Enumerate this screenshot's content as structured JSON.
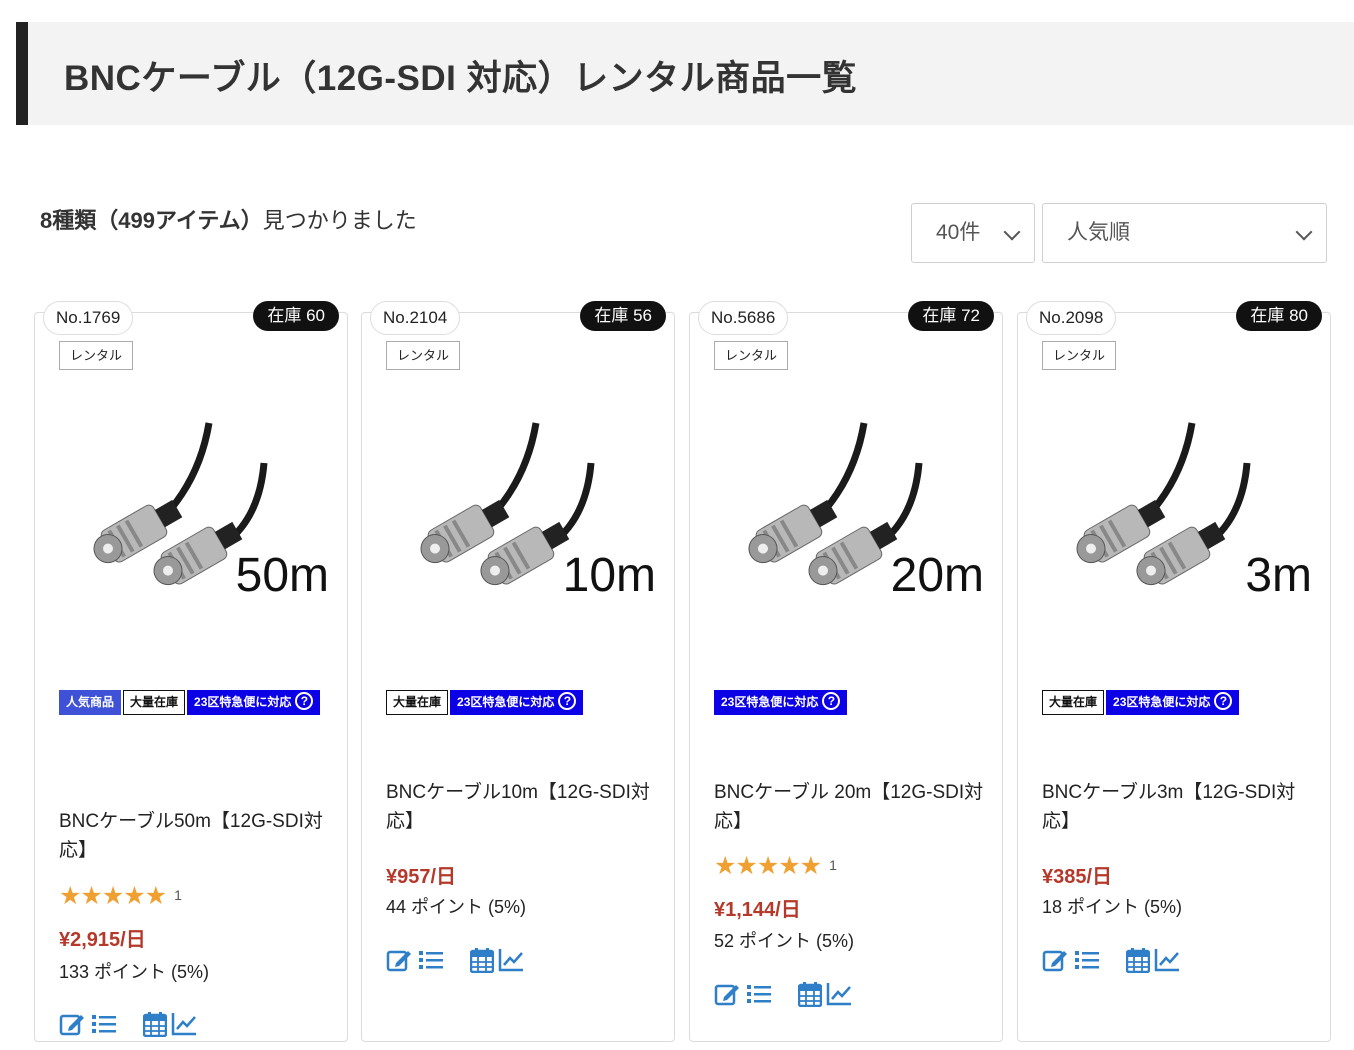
{
  "page": {
    "title": "BNCケーブル（12G-SDI 対応）レンタル商品一覧",
    "result_kinds": "8種類",
    "result_items": "（499アイテム）",
    "result_suffix": "見つかりました"
  },
  "controls": {
    "per_page": "40件",
    "sort": "人気順"
  },
  "colors": {
    "accent_blue": "#3f51d6",
    "express_blue": "#0b00e6",
    "price_red": "#b5392b",
    "star": "#f0a030",
    "icon_blue": "#2f7fc8"
  },
  "products": [
    {
      "no": "No.1769",
      "stock": "在庫 60",
      "type": "レンタル",
      "image_length": "50m",
      "badges": [
        "人気商品",
        "大量在庫",
        "23区特急便に対応"
      ],
      "name": "BNCケーブル50m【12G-SDI対応】",
      "stars": "★★★★★",
      "rating_count": "1",
      "price": "¥2,915/日",
      "points": "133 ポイント (5%)"
    },
    {
      "no": "No.2104",
      "stock": "在庫 56",
      "type": "レンタル",
      "image_length": "10m",
      "badges": [
        "大量在庫",
        "23区特急便に対応"
      ],
      "name": "BNCケーブル10m【12G-SDI対応】",
      "price": "¥957/日",
      "points": "44 ポイント (5%)"
    },
    {
      "no": "No.5686",
      "stock": "在庫 72",
      "type": "レンタル",
      "image_length": "20m",
      "badges": [
        "23区特急便に対応"
      ],
      "name": "BNCケーブル 20m【12G-SDI対応】",
      "stars": "★★★★★",
      "rating_count": "1",
      "price": "¥1,144/日",
      "points": "52 ポイント (5%)"
    },
    {
      "no": "No.2098",
      "stock": "在庫 80",
      "type": "レンタル",
      "image_length": "3m",
      "badges": [
        "大量在庫",
        "23区特急便に対応"
      ],
      "name": "BNCケーブル3m【12G-SDI対応】",
      "price": "¥385/日",
      "points": "18 ポイント (5%)"
    }
  ],
  "icons": {
    "q_mark": "?",
    "action_icons": [
      "edit-icon",
      "list-icon",
      "calendar-icon",
      "chart-icon"
    ]
  }
}
